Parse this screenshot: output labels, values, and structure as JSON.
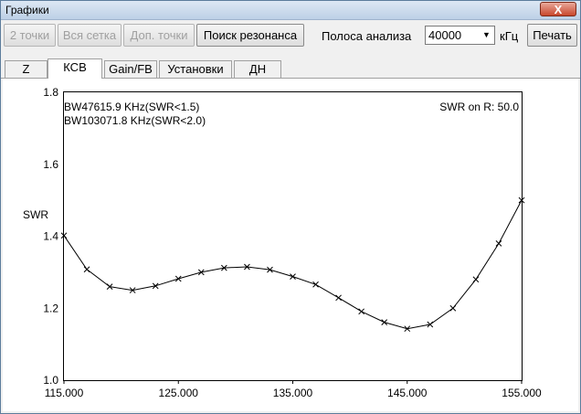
{
  "window": {
    "title": "Графики",
    "close_label": "X"
  },
  "toolbar": {
    "btn_2points": "2 точки",
    "btn_all_grid": "Вся сетка",
    "btn_extra_points": "Доп. точки",
    "btn_find_resonance": "Поиск резонанса",
    "band_label": "Полоса анализа",
    "band_value": "40000",
    "band_unit": "кГц",
    "btn_print": "Печать"
  },
  "tabs": [
    {
      "label": "Z",
      "active": false
    },
    {
      "label": "КСВ",
      "active": true
    },
    {
      "label": "Gain/FB",
      "active": false
    },
    {
      "label": "Установки",
      "active": false
    },
    {
      "label": "ДН",
      "active": false
    }
  ],
  "chart_data": {
    "type": "line",
    "ylabel": "SWR",
    "xlim": [
      115000,
      155000
    ],
    "ylim": [
      1.0,
      1.8
    ],
    "xticks": [
      "115.000",
      "125.000",
      "135.000",
      "145.000",
      "155.000"
    ],
    "xtick_values": [
      115000,
      125000,
      135000,
      145000,
      155000
    ],
    "yticks": [
      "1.0",
      "1.2",
      "1.4",
      "1.6",
      "1.8"
    ],
    "ytick_values": [
      1.0,
      1.2,
      1.4,
      1.6,
      1.8
    ],
    "annotations": {
      "bw1": "BW47615.9 KHz(SWR<1.5)",
      "bw2": "BW103071.8 KHz(SWR<2.0)",
      "swr_ref": "SWR on R: 50.0"
    },
    "series": [
      {
        "color": "#000000",
        "marker": "x",
        "x": [
          115000,
          117000,
          119000,
          121000,
          123000,
          125000,
          127000,
          129000,
          131000,
          133000,
          135000,
          137000,
          139000,
          141000,
          143000,
          145000,
          147000,
          149000,
          151000,
          153000,
          155000
        ],
        "y": [
          1.402,
          1.308,
          1.26,
          1.25,
          1.262,
          1.282,
          1.3,
          1.312,
          1.315,
          1.307,
          1.288,
          1.266,
          1.229,
          1.191,
          1.161,
          1.143,
          1.155,
          1.2,
          1.28,
          1.38,
          1.5
        ]
      }
    ]
  }
}
